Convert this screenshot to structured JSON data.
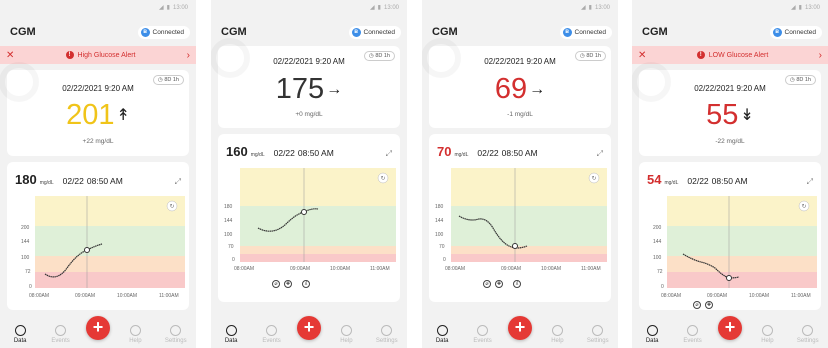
{
  "status_time": "13:00",
  "screens": [
    {
      "app_title": "CGM",
      "connection": "Connected",
      "alert": "High Glucose Alert",
      "timer": "8D 1h",
      "reading": {
        "date": "02/22/2021  9:20 AM",
        "value": "201",
        "color": "#f0c419",
        "arrow": "↟",
        "delta": "+22 mg/dL"
      },
      "chart": {
        "current_value": "180",
        "unit": "mg/dL",
        "date": "02/22",
        "time": "08:50 AM",
        "y_ticks": [
          "200",
          "144",
          "100",
          "72",
          "0"
        ],
        "x_ticks": [
          "08:00AM",
          "09:00AM",
          "10:00AM",
          "11:00AM"
        ]
      },
      "nav": [
        "Data",
        "Events",
        "Help",
        "Settings"
      ]
    },
    {
      "app_title": "CGM",
      "connection": "Connected",
      "alert": "",
      "timer": "8D 1h",
      "reading": {
        "date": "02/22/2021  9:20 AM",
        "value": "175",
        "color": "#333333",
        "arrow": "→",
        "delta": "+0 mg/dL"
      },
      "chart": {
        "current_value": "160",
        "unit": "mg/dL",
        "date": "02/22",
        "time": "08:50 AM",
        "y_ticks": [
          "180",
          "144",
          "100",
          "70",
          "0"
        ],
        "x_ticks": [
          "08:00AM",
          "09:00AM",
          "10:00AM",
          "11:00AM"
        ]
      },
      "nav": [
        "Data",
        "Events",
        "Help",
        "Settings"
      ]
    },
    {
      "app_title": "CGM",
      "connection": "Connected",
      "alert": "",
      "timer": "8D 1h",
      "reading": {
        "date": "02/22/2021  9:20 AM",
        "value": "69",
        "color": "#d32f2f",
        "arrow": "→",
        "delta": "-1 mg/dL"
      },
      "chart": {
        "current_value": "70",
        "unit": "mg/dL",
        "date": "02/22",
        "time": "08:50 AM",
        "y_ticks": [
          "180",
          "144",
          "100",
          "70",
          "0"
        ],
        "x_ticks": [
          "08:00AM",
          "09:00AM",
          "10:00AM",
          "11:00AM"
        ]
      },
      "nav": [
        "Data",
        "Events",
        "Help",
        "Settings"
      ]
    },
    {
      "app_title": "CGM",
      "connection": "Connected",
      "alert": "LOW Glucose Alert",
      "timer": "8D 1h",
      "reading": {
        "date": "02/22/2021  9:20 AM",
        "value": "55",
        "color": "#d32f2f",
        "arrow": "↡",
        "delta": "-22 mg/dL"
      },
      "chart": {
        "current_value": "54",
        "unit": "mg/dL",
        "date": "02/22",
        "time": "08:50 AM",
        "y_ticks": [
          "200",
          "144",
          "100",
          "72",
          "0"
        ],
        "x_ticks": [
          "08:00AM",
          "09:00AM",
          "10:00AM",
          "11:00AM"
        ]
      },
      "nav": [
        "Data",
        "Events",
        "Help",
        "Settings"
      ]
    }
  ]
}
